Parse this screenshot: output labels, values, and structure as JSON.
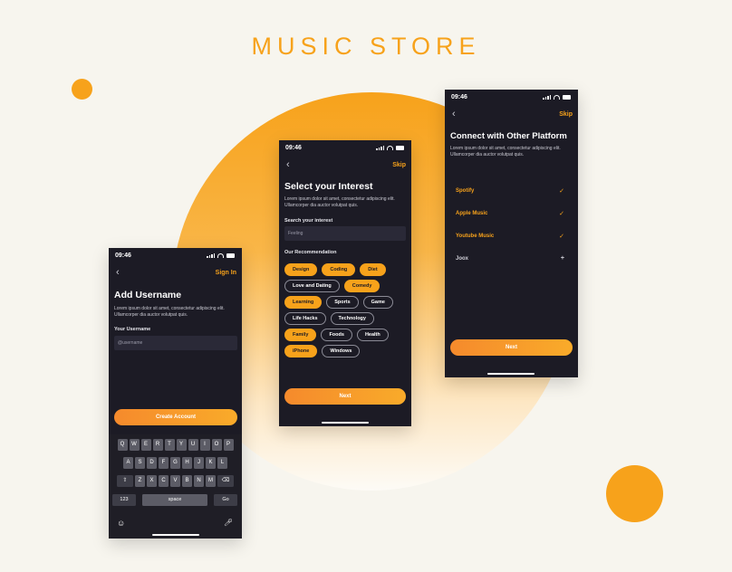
{
  "page_title": "MUSIC STORE",
  "colors": {
    "accent": "#f7a21b",
    "phone_bg": "#1c1b25",
    "page_bg": "#f7f5ee"
  },
  "screen1": {
    "time": "09:46",
    "top_link": "Sign In",
    "heading": "Add Username",
    "lorem": "Lorem ipsum dolor sit amet, consectetur adipiscing elit. Ullamcorper dia auctor volutpat quis.",
    "field_label": "Your Username",
    "field_placeholder": "@username",
    "button": "Create Account",
    "keyboard": {
      "row1": [
        "Q",
        "W",
        "E",
        "R",
        "T",
        "Y",
        "U",
        "I",
        "O",
        "P"
      ],
      "row2": [
        "A",
        "S",
        "D",
        "F",
        "G",
        "H",
        "J",
        "K",
        "L"
      ],
      "row3": [
        "Z",
        "X",
        "C",
        "V",
        "B",
        "N",
        "M"
      ],
      "num": "123",
      "space": "space",
      "go": "Go"
    }
  },
  "screen2": {
    "time": "09:46",
    "top_link": "Skip",
    "heading": "Select your Interest",
    "lorem": "Lorem ipsum dolor sit amet, consectetur adipiscing elit. Ullamcorper dia auctor volutpat quis.",
    "search_label": "Search your interest",
    "search_value": "Feeling",
    "rec_label": "Our Recommendation",
    "chips": [
      {
        "label": "Design",
        "selected": true
      },
      {
        "label": "Coding",
        "selected": true
      },
      {
        "label": "Diet",
        "selected": true
      },
      {
        "label": "Love and Dating",
        "selected": false
      },
      {
        "label": "Comedy",
        "selected": true
      },
      {
        "label": "Learning",
        "selected": true
      },
      {
        "label": "Sports",
        "selected": false
      },
      {
        "label": "Game",
        "selected": false
      },
      {
        "label": "Life Hacks",
        "selected": false
      },
      {
        "label": "Technology",
        "selected": false
      },
      {
        "label": "Family",
        "selected": true
      },
      {
        "label": "Foods",
        "selected": false
      },
      {
        "label": "Health",
        "selected": false
      },
      {
        "label": "iPhone",
        "selected": true
      },
      {
        "label": "Windows",
        "selected": false
      }
    ],
    "button": "Next"
  },
  "screen3": {
    "time": "09:46",
    "top_link": "Skip",
    "heading": "Connect with Other Platform",
    "lorem": "Lorem ipsum dolor sit amet, consectetur adipiscing elit. Ullamcorper dia auctor volutpat quis.",
    "platforms": [
      {
        "name": "Spotify",
        "connected": true,
        "mark": "✓"
      },
      {
        "name": "Apple Music",
        "connected": true,
        "mark": "✓"
      },
      {
        "name": "Youtube Music",
        "connected": true,
        "mark": "✓"
      },
      {
        "name": "Joox",
        "connected": false,
        "mark": "+"
      }
    ],
    "button": "Next"
  }
}
